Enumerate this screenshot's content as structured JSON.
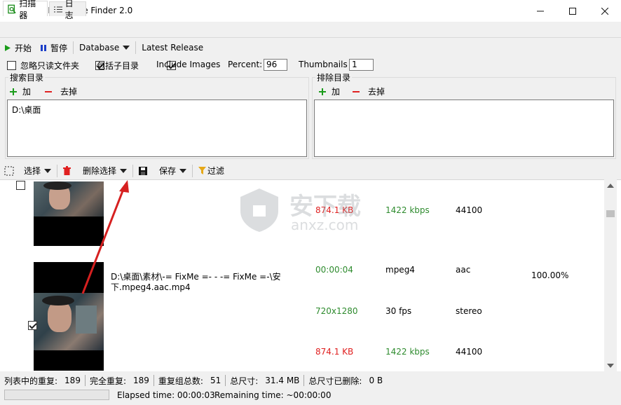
{
  "window": {
    "title": "Video Duplicate Finder 2.0"
  },
  "tabs": [
    {
      "label": "扫描器",
      "active": true
    },
    {
      "label": "日志",
      "active": false
    }
  ],
  "toolbar": {
    "start_label": "开始",
    "pause_label": "暂停",
    "database_label": "Database",
    "latest_release_label": "Latest Release"
  },
  "options": {
    "ignore_readonly_label": "忽略只读文件夹",
    "ignore_readonly_checked": false,
    "include_subdirs_label": "包括子目录",
    "include_subdirs_checked": true,
    "include_images_label": "Include Images",
    "include_images_checked": true,
    "percent_label": "Percent:",
    "percent_value": "96",
    "thumbnails_label": "Thumbnails",
    "thumbnails_value": "1"
  },
  "search_dirs": {
    "title": "搜索目录",
    "add_label": "加",
    "remove_label": "去掉",
    "items": [
      "D:\\桌面"
    ]
  },
  "exclude_dirs": {
    "title": "排除目录",
    "add_label": "加",
    "remove_label": "去掉",
    "items": []
  },
  "results_toolbar": {
    "select_label": "选择",
    "delete_selected_label": "删除选择",
    "save_label": "保存",
    "filter_label": "过滤"
  },
  "results": [
    {
      "checked": false,
      "size": "874.1 KB",
      "bitrate": "1422 kbps",
      "sample_rate": "44100"
    },
    {
      "checked": true,
      "path_line1": "D:\\桌面\\素材\\-= FixMe =- - -= FixMe =-\\安",
      "path_line2": "下.mpeg4.aac.mp4",
      "duration": "00:00:04",
      "format": "mpeg4",
      "audio_codec": "aac",
      "similarity": "100.00%",
      "resolution": "720x1280",
      "fps": "30 fps",
      "audio_channels": "stereo",
      "size": "874.1 KB",
      "bitrate": "1422 kbps",
      "sample_rate": "44100"
    }
  ],
  "statusbar": {
    "dup_in_list_label": "列表中的重复:",
    "dup_in_list_value": "189",
    "full_dup_label": "完全重复:",
    "full_dup_value": "189",
    "groups_label": "重复组总数:",
    "groups_value": "51",
    "total_size_label": "总尺寸:",
    "total_size_value": "31.4 MB",
    "deleted_label": "总尺寸已删除:",
    "deleted_value": "0 B"
  },
  "progress": {
    "elapsed": "Elapsed time: 00:00:03",
    "remaining": "Remaining time: ~00:00:00",
    "fraction": 0
  },
  "watermark": {
    "text": "安下载",
    "sub": "anxz.com"
  },
  "colors": {
    "accent_red": "#e02020",
    "accent_green": "#2e8b2e",
    "play_green": "#1a9c1a",
    "pause_blue": "#1c3fc8"
  }
}
